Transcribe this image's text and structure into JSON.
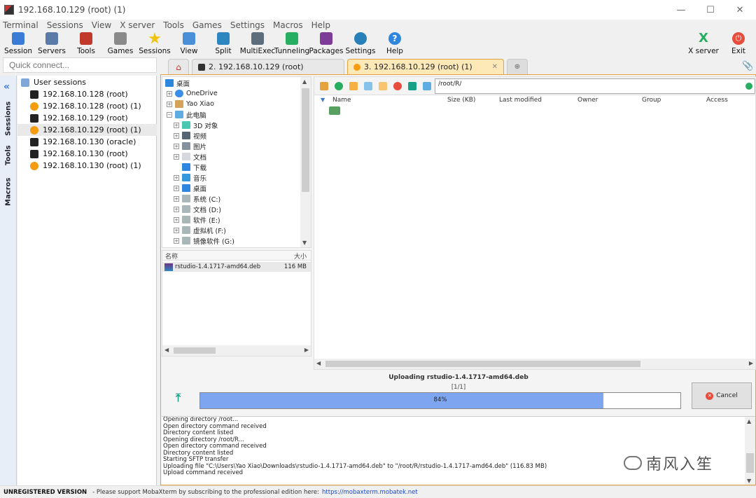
{
  "window": {
    "title": "192.168.10.129 (root) (1)",
    "minimize": "—",
    "maximize": "☐",
    "close": "✕"
  },
  "menu": [
    "Terminal",
    "Sessions",
    "View",
    "X server",
    "Tools",
    "Games",
    "Settings",
    "Macros",
    "Help"
  ],
  "toolbar": [
    {
      "label": "Session",
      "icon": "session-icon",
      "color": "#3a7bd5"
    },
    {
      "label": "Servers",
      "icon": "servers-icon",
      "color": "#5a7aa8"
    },
    {
      "label": "Tools",
      "icon": "tools-icon",
      "color": "#c0392b"
    },
    {
      "label": "Games",
      "icon": "games-icon",
      "color": "#8a8a8a"
    },
    {
      "label": "Sessions",
      "icon": "star-icon",
      "color": "#f1c40f"
    },
    {
      "label": "View",
      "icon": "view-icon",
      "color": "#4a90d9"
    },
    {
      "label": "Split",
      "icon": "split-icon",
      "color": "#2e86c1"
    },
    {
      "label": "MultiExec",
      "icon": "multiexec-icon",
      "color": "#5d6d7e"
    },
    {
      "label": "Tunneling",
      "icon": "tunneling-icon",
      "color": "#27ae60"
    },
    {
      "label": "Packages",
      "icon": "packages-icon",
      "color": "#7d3c98"
    },
    {
      "label": "Settings",
      "icon": "gear-icon",
      "color": "#2980b9"
    },
    {
      "label": "Help",
      "icon": "help-icon",
      "color": "#2e86de"
    }
  ],
  "toolbar_right": [
    {
      "label": "X server",
      "icon": "xserver-icon",
      "color": "#27ae60"
    },
    {
      "label": "Exit",
      "icon": "power-icon",
      "color": "#e74c3c"
    }
  ],
  "quick_connect": {
    "placeholder": "Quick connect..."
  },
  "tabs": [
    {
      "label": "2. 192.168.10.129 (root)",
      "active": false
    },
    {
      "label": "3. 192.168.10.129 (root) (1)",
      "active": true
    }
  ],
  "sidebar_tabs": [
    "Sessions",
    "Tools",
    "Macros"
  ],
  "sessions": {
    "header": "User sessions",
    "items": [
      {
        "label": "192.168.10.128 (root)",
        "type": "ssh"
      },
      {
        "label": "192.168.10.128 (root) (1)",
        "type": "sftp"
      },
      {
        "label": "192.168.10.129 (root)",
        "type": "ssh"
      },
      {
        "label": "192.168.10.129 (root) (1)",
        "type": "sftp"
      },
      {
        "label": "192.168.10.130 (oracle)",
        "type": "ssh"
      },
      {
        "label": "192.168.10.130 (root)",
        "type": "ssh"
      },
      {
        "label": "192.168.10.130 (root) (1)",
        "type": "sftp"
      }
    ]
  },
  "local_tree": [
    {
      "label": "桌面",
      "level": 0
    },
    {
      "label": "OneDrive",
      "level": 1
    },
    {
      "label": "Yao Xiao",
      "level": 1
    },
    {
      "label": "此电脑",
      "level": 1
    },
    {
      "label": "3D 对象",
      "level": 2
    },
    {
      "label": "视频",
      "level": 2
    },
    {
      "label": "图片",
      "level": 2
    },
    {
      "label": "文档",
      "level": 2
    },
    {
      "label": "下载",
      "level": 2
    },
    {
      "label": "音乐",
      "level": 2
    },
    {
      "label": "桌面",
      "level": 2
    },
    {
      "label": "系统 (C:)",
      "level": 2
    },
    {
      "label": "文档 (D:)",
      "level": 2
    },
    {
      "label": "软件 (E:)",
      "level": 2
    },
    {
      "label": "虚拟机 (F:)",
      "level": 2
    },
    {
      "label": "镜像软件 (G:)",
      "level": 2
    }
  ],
  "local_files": {
    "col_name": "名称",
    "col_size": "大小",
    "rows": [
      {
        "name": "rstudio-1.4.1717-amd64.deb",
        "size": "116 MB"
      }
    ]
  },
  "remote": {
    "path": "/root/R/",
    "columns": [
      "Name",
      "Size (KB)",
      "Last modified",
      "Owner",
      "Group",
      "Access"
    ]
  },
  "upload": {
    "title": "Uploading rstudio-1.4.1717-amd64.deb",
    "counter": "[1/1]",
    "progress": 84,
    "progress_text": "84%",
    "cancel": "Cancel"
  },
  "log": [
    "Opening directory /root...",
    "Open directory command received",
    "Directory content listed",
    "Opening directory /root/R...",
    "Open directory command received",
    "Directory content listed",
    "Starting SFTP transfer",
    "Uploading file \"C:\\Users\\Yao Xiao\\Downloads\\rstudio-1.4.1717-amd64.deb\" to \"/root/R/rstudio-1.4.1717-amd64.deb\" (116.83 MB)",
    "Upload command received"
  ],
  "watermark": "南风入笙",
  "status": {
    "version": "UNREGISTERED VERSION",
    "message": "-  Please support MobaXterm by subscribing to the professional edition here:",
    "link": "https://mobaxterm.mobatek.net"
  }
}
